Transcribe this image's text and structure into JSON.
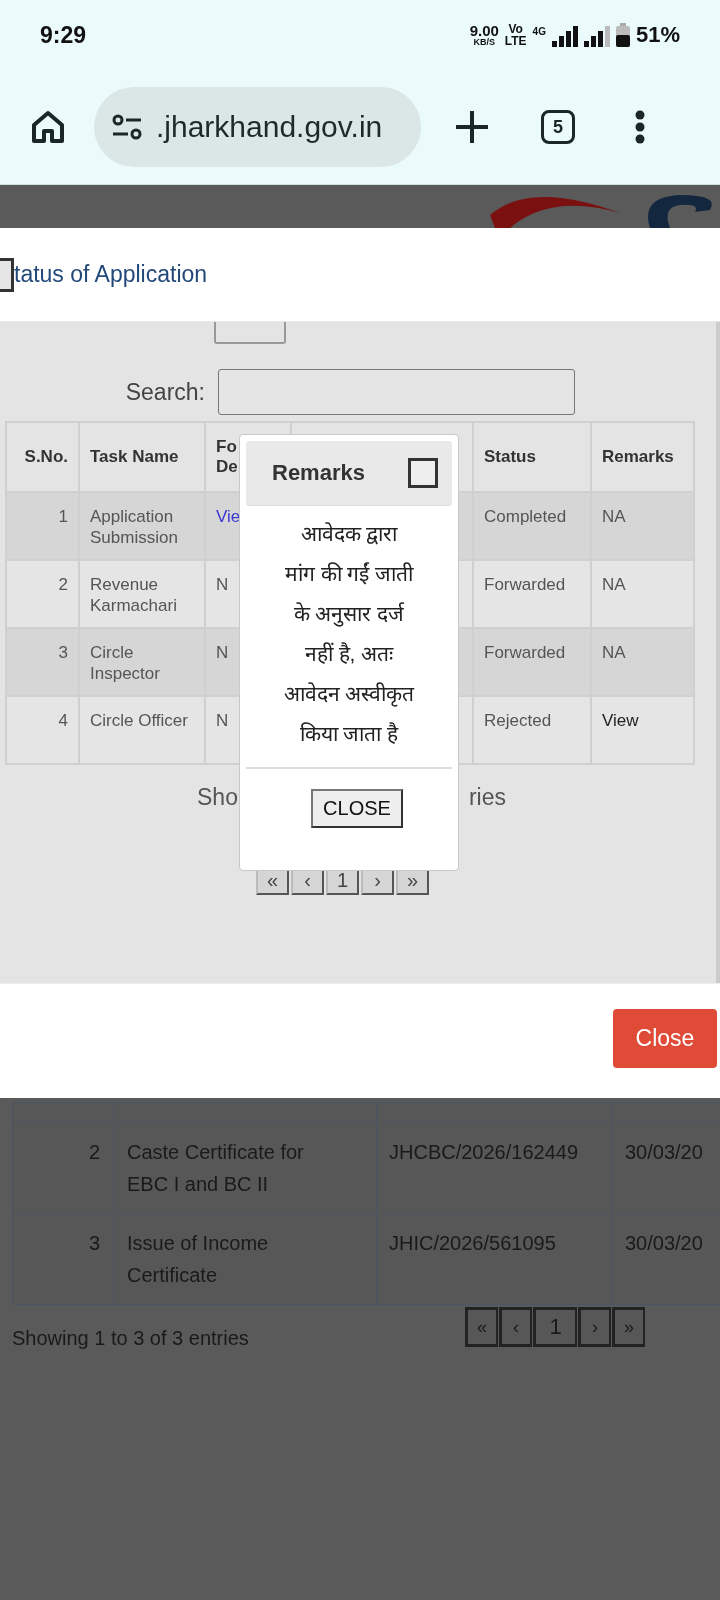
{
  "status_bar": {
    "time": "9:29",
    "net_speed": "9.00",
    "net_unit": "KB/S",
    "volte_top": "Vo",
    "volte_bottom": "LTE",
    "network": "4G",
    "battery": "51%"
  },
  "browser": {
    "url": ".jharkhand.gov.in",
    "tab_count": "5"
  },
  "modal": {
    "title": "tatus of Application",
    "search_label": "Search:",
    "columns": [
      {
        "label": "S.No."
      },
      {
        "label": "Task Name"
      },
      {
        "label": "Fo\nDe"
      },
      {
        "label": "Status"
      },
      {
        "label": "Remarks"
      }
    ],
    "rows": [
      {
        "sno": "1",
        "task": "Application Submission",
        "column_3": {
          "text": "Vie",
          "kind": "link"
        },
        "status": "Completed",
        "remarks": {
          "text": "NA",
          "kind": "text"
        }
      },
      {
        "sno": "2",
        "task": "Revenue Karmachari",
        "column_3": {
          "text": "N",
          "kind": "text"
        },
        "status": "Forwarded",
        "remarks": {
          "text": "NA",
          "kind": "text"
        }
      },
      {
        "sno": "3",
        "task": "Circle Inspector",
        "column_3": {
          "text": "N",
          "kind": "text"
        },
        "status": "Forwarded",
        "remarks": {
          "text": "NA",
          "kind": "text"
        }
      },
      {
        "sno": "4",
        "task": "Circle Officer",
        "column_3": {
          "text": "N",
          "kind": "text"
        },
        "status": "Rejected",
        "remarks": {
          "text": "View",
          "kind": "link"
        }
      }
    ],
    "info_left": "Sho",
    "info_right": "ries",
    "pagination": [
      "«",
      "‹",
      "1",
      "›",
      "»"
    ],
    "close_button": "Close"
  },
  "popup": {
    "title": "Remarks",
    "text": "आवेदक द्वारा\nमांग की गईं जाती\nके अनुसार दर्ज\nनहीं है, अतः\nआवेदन अस्वीकृत\nकिया जाता है",
    "button": "CLOSE"
  },
  "page": {
    "rows": [
      {
        "sno": "2",
        "service": "Caste Certificate for EBC I and BC II",
        "app_no": "JHCBC/2026/162449",
        "date": "30/03/20"
      },
      {
        "sno": "3",
        "service": "Issue of Income Certificate",
        "app_no": "JHIC/2026/561095",
        "date": "30/03/20"
      }
    ],
    "info": "Showing 1 to 3 of 3 entries",
    "pagination": [
      "«",
      "‹",
      "1",
      "›",
      "»"
    ]
  }
}
